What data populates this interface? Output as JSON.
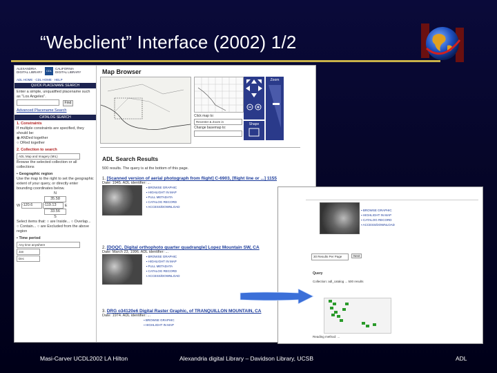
{
  "slide": {
    "title": "“Webclient” Interface (2002)  1/2",
    "footer_left": "Masi-Carver UCDL2002 LA Hilton",
    "footer_center": "Alexandria digital Library – Davidson Library, UCSB",
    "footer_right": "ADL"
  },
  "left_panel": {
    "logo_left": "ALEXANDRIA DIGITAL LIBRARY",
    "logo_mid": "CDL",
    "logo_right": "CALIFORNIA DIGITAL LIBRARY",
    "nav_links": "ADL HOME · CDL HOME · HELP",
    "quick_search_bar": "QUICK PLACENAME SEARCH",
    "quick_search_text": "Enter a simple, unqualified placename such as \"Los Angeles\".",
    "find_button": "Find",
    "advanced_link": "Advanced Placename Search",
    "catalog_bar": "CATALOG SEARCH",
    "constraints_heading": "1. Constraints",
    "constraints_text": "If multiple constraints are specified, they should be:",
    "opt_and": "ANDed together",
    "opt_or": "ORed together",
    "collection_heading": "2. Collection to search",
    "collection_value": "ADL Map and Imagery (MIL)",
    "collection_text": "Browse the selected collection or all collections",
    "geo_heading": "▪ Geographic region",
    "geo_text": "Use the map to the right to set the geographic extent of your query, or directly enter bounding coordinates below.",
    "coord_n": "35.58",
    "coord_w": "-120.6",
    "coord_e": "-119.13",
    "coord_s": "33.56",
    "select_items": "Select items that: ○ are Inside... ○ Overlap... ○ Contain... ○ are Excluded from the above region",
    "time_heading": "▪ Time period",
    "time_value_1": "Any time anywhere",
    "time_value_2": "Jan",
    "time_value_3": "Dec"
  },
  "map_browser": {
    "title": "Map Browser",
    "click_map_label": "Click map to:",
    "click_map_value": "Recenter & Zoom in",
    "change_label": "Change basemap to:",
    "zoom_label": "Zoom",
    "shape_label": "Shape",
    "refresh_label": "Refresh"
  },
  "results": {
    "title": "ADL Search Results",
    "summary": "500 results. The query is at the bottom of this page.",
    "items": [
      {
        "num": "1.",
        "heading": "[Scanned version of aerial photograph from flight] C-6903, [flight line or ...] 1155",
        "date": "Date: 1945. ADL identifier: ...",
        "actions": [
          "BROWSE GRAPHIC",
          "HIGHLIGHT IN MAP",
          "FULL METADATA",
          "CATALOG RECORD",
          "ACCESS/DOWNLOAD"
        ]
      },
      {
        "num": "2.",
        "heading": "[DOQC, Digital orthophoto quarter quadrangle] Lopez Mountain SW, CA",
        "date": "Date: March 23, 1996. ADL identifier: ...",
        "actions": [
          "BROWSE GRAPHIC",
          "HIGHLIGHT IN MAP",
          "FULL METADATA",
          "CATALOG RECORD",
          "ACCESS/DOWNLOAD"
        ]
      },
      {
        "num": "3.",
        "heading": "DRG o34120e6 Digital Raster Graphic, of TRANQUILLON MOUNTAIN, CA",
        "date": "Date: 1974. ADL identifier: ...",
        "actions": [
          "BROWSE GRAPHIC",
          "HIGHLIGHT IN MAP"
        ]
      }
    ]
  },
  "overlay": {
    "actions": [
      "BROWSE GRAPHIC",
      "HIGHLIGHT IN MAP",
      "CATALOG RECORD",
      "ACCESS/DOWNLOAD"
    ],
    "per_page": "30 Results Per Page",
    "next_button": "Next",
    "query_label": "Query",
    "collection_line": "Collection: adl_catalog ... 500 results",
    "footer_text": "Reading method: ..."
  },
  "colors": {
    "background": "#06062a",
    "rule": "#c9b24a",
    "title_text": "#ffffff",
    "adl_blue": "#2a3a8a",
    "link": "#1a3a9a",
    "arrow": "#3b6fd8"
  }
}
